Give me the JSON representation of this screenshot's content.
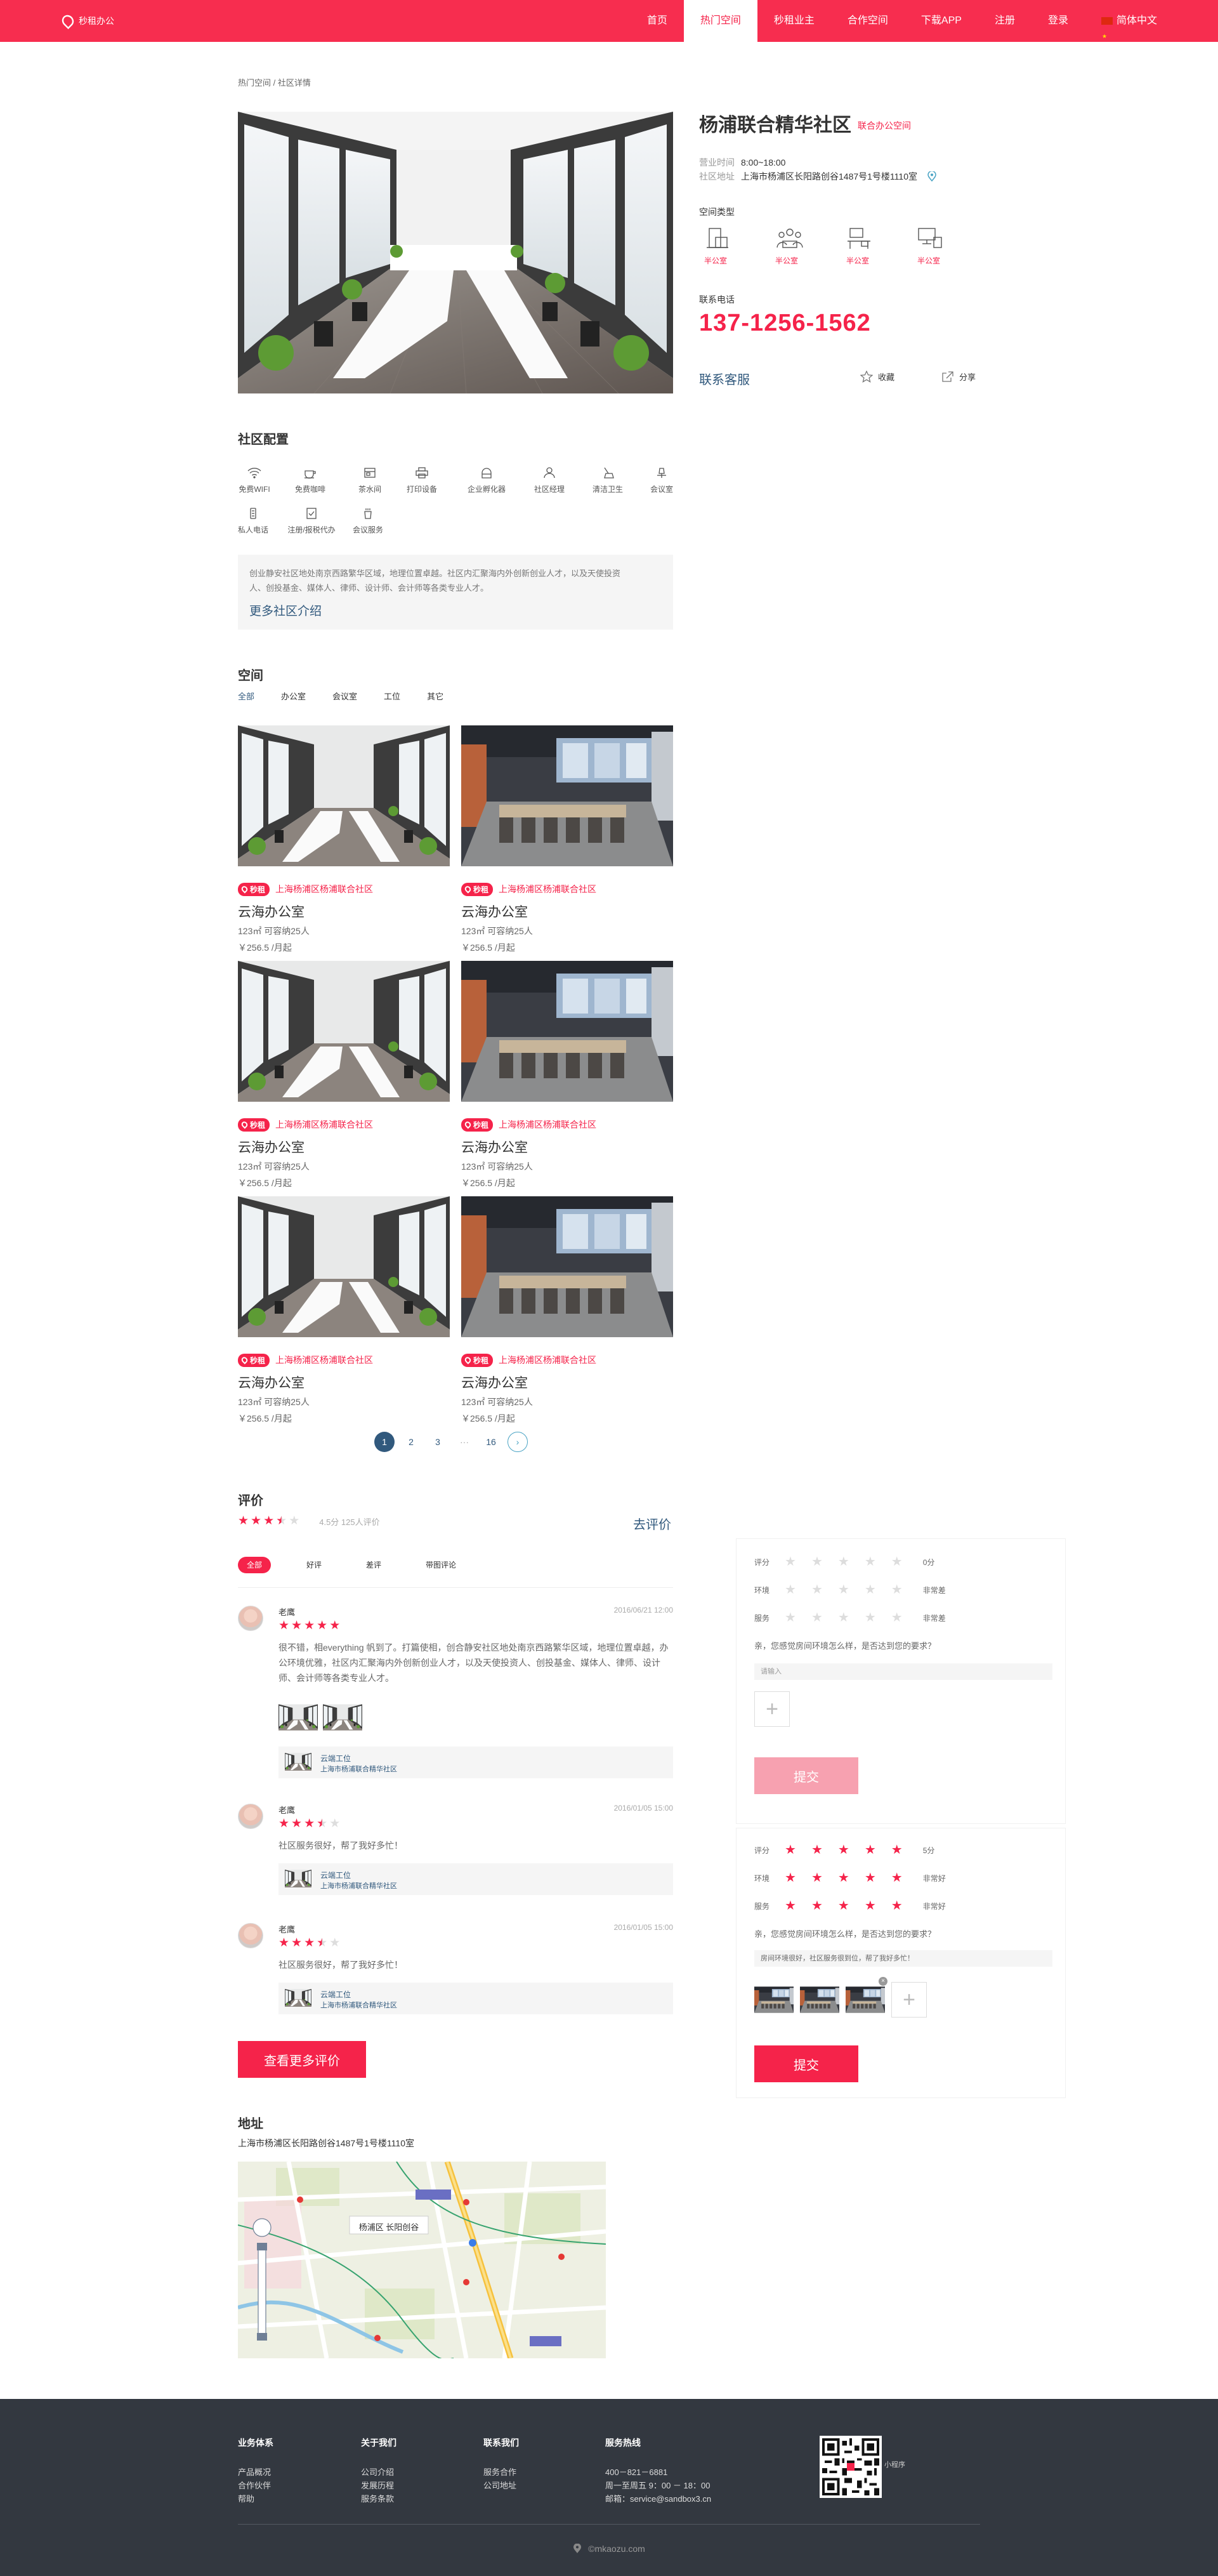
{
  "header": {
    "logo_text": "秒租办公",
    "nav": [
      "首页",
      "热门空间",
      "秒租业主",
      "合作空间",
      "下载APP",
      "注册",
      "登录",
      "简体中文"
    ],
    "active_index": 1
  },
  "breadcrumb": "热门空间 / 社区详情",
  "detail": {
    "title": "杨浦联合精华社区",
    "tag": "联合办公空间",
    "hours_label": "营业时间",
    "hours": "8:00~18:00",
    "address_label": "社区地址",
    "address": "上海市杨浦区长阳路创谷1487号1号楼1110室",
    "space_type_label": "空间类型",
    "space_types": [
      "半公室",
      "半公室",
      "半公室",
      "半公室"
    ],
    "phone_label": "联系电话",
    "phone": "137-1256-1562",
    "service": "联系客服",
    "collect": "收藏",
    "share": "分享"
  },
  "config": {
    "title": "社区配置",
    "facilities": [
      "免费WIFI",
      "免费咖啡",
      "茶水间",
      "打印设备",
      "企业孵化器",
      "社区经理",
      "清洁卫生",
      "会议室",
      "私人电话",
      "注册/报税代办",
      "会议服务"
    ],
    "desc": "创业静安社区地处南京西路繁华区域，地理位置卓越。社区内汇聚海内外创新创业人才，以及天使投资人、创投基金、媒体人、律师、设计师、会计师等各类专业人才。",
    "more": "更多社区介绍"
  },
  "spaces": {
    "title": "空间",
    "tabs": [
      "全部",
      "办公室",
      "会议室",
      "工位",
      "其它"
    ],
    "badge": "秒租",
    "cards": [
      {
        "loc": "上海杨浦区杨浦联合社区",
        "name": "云海办公室",
        "size": "123㎡  可容纳25人",
        "price": "￥256.5 /月起"
      },
      {
        "loc": "上海杨浦区杨浦联合社区",
        "name": "云海办公室",
        "size": "123㎡  可容纳25人",
        "price": "￥256.5 /月起"
      },
      {
        "loc": "上海杨浦区杨浦联合社区",
        "name": "云海办公室",
        "size": "123㎡  可容纳25人",
        "price": "￥256.5 /月起"
      },
      {
        "loc": "上海杨浦区杨浦联合社区",
        "name": "云海办公室",
        "size": "123㎡  可容纳25人",
        "price": "￥256.5 /月起"
      },
      {
        "loc": "上海杨浦区杨浦联合社区",
        "name": "云海办公室",
        "size": "123㎡  可容纳25人",
        "price": "￥256.5 /月起"
      },
      {
        "loc": "上海杨浦区杨浦联合社区",
        "name": "云海办公室",
        "size": "123㎡  可容纳25人",
        "price": "￥256.5 /月起"
      }
    ],
    "pages": [
      "1",
      "2",
      "3",
      "···",
      "16"
    ],
    "next": "›"
  },
  "reviews": {
    "title": "评价",
    "rating": 3.5,
    "score_text": "4.5分  125人评价",
    "go": "去评价",
    "tabs": [
      "全部",
      "好评",
      "差评",
      "带图评论"
    ],
    "items": [
      {
        "name": "老鹰",
        "date": "2016/06/21  12:00",
        "rating": 5,
        "text": "很不错，相everything 帆到了。打篇使相，创合静安社区地处南京西路繁华区域，地理位置卓越，办公环境优雅，社区内汇聚海内外创新创业人才，以及天使投资人、创投基金、媒体人、律师、设计师、会计师等各类专业人才。",
        "room": "云端工位",
        "room_loc": "上海市杨浦联合精华社区"
      },
      {
        "name": "老鹰",
        "date": "2016/01/05  15:00",
        "rating": 3.5,
        "text": "社区服务很好，帮了我好多忙！",
        "room": "云端工位",
        "room_loc": "上海市杨浦联合精华社区"
      },
      {
        "name": "老鹰",
        "date": "2016/01/05  15:00",
        "rating": 3.5,
        "text": "社区服务很好，帮了我好多忙！",
        "room": "云端工位",
        "room_loc": "上海市杨浦联合精华社区"
      }
    ],
    "more": "查看更多评价"
  },
  "form1": {
    "rows": [
      {
        "label": "评分",
        "note": "0分",
        "rating": 0
      },
      {
        "label": "环境",
        "note": "非常差",
        "rating": 0
      },
      {
        "label": "服务",
        "note": "非常差",
        "rating": 0
      }
    ],
    "question": "亲，您感觉房间环境怎么样，是否达到您的要求？",
    "placeholder": "请输入",
    "submit": "提交"
  },
  "form2": {
    "rows": [
      {
        "label": "评分",
        "note": "5分",
        "rating": 5
      },
      {
        "label": "环境",
        "note": "非常好",
        "rating": 5
      },
      {
        "label": "服务",
        "note": "非常好",
        "rating": 5
      }
    ],
    "question": "亲，您感觉房间环境怎么样，是否达到您的要求？",
    "value": "房间环境很好，社区服务很到位，帮了我好多忙！",
    "submit": "提交"
  },
  "address": {
    "title": "地址",
    "text": "上海市杨浦区长阳路创谷1487号1号楼1110室",
    "map_label": "杨浦区 长阳创谷"
  },
  "footer": {
    "cols": [
      {
        "title": "业务体系",
        "items": [
          "产品概况",
          "合作伙伴",
          "帮助"
        ]
      },
      {
        "title": "关于我们",
        "items": [
          "公司介绍",
          "发展历程",
          "服务条款"
        ]
      },
      {
        "title": "联系我们",
        "items": [
          "服务合作",
          "公司地址"
        ]
      },
      {
        "title": "服务热线",
        "items": [
          "400－821－6881",
          "周一至周五 9：00 － 18：00",
          "邮箱：service@sandbox3.cn"
        ]
      }
    ],
    "qr_label": "小程序",
    "copyright": "©mkaozu.com"
  },
  "colors": {
    "brand": "#f72d4f",
    "link": "#31597d",
    "footer": "#333840"
  }
}
